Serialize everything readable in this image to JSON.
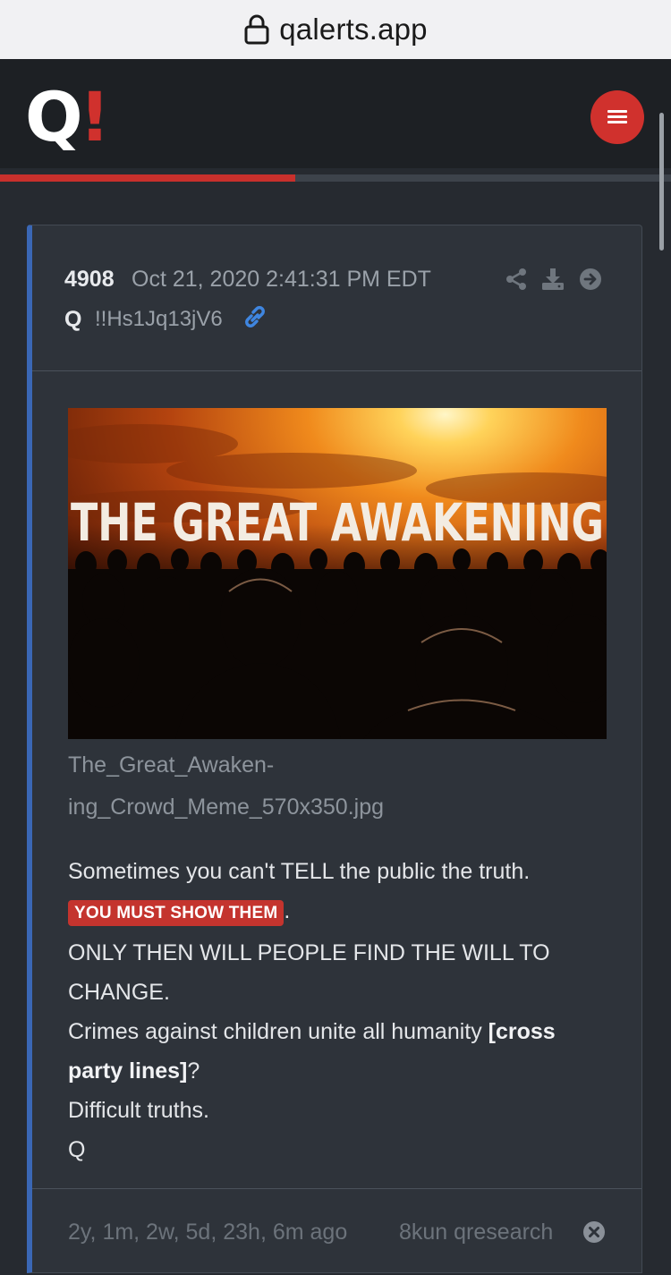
{
  "browser": {
    "url": "qalerts.app"
  },
  "header": {
    "logo_q": "Q",
    "logo_bang": "!",
    "accent_color": "#d0312d",
    "reading_progress": 0.44
  },
  "post": {
    "number": "4908",
    "date": "Oct 21, 2020 2:41:31 PM EDT",
    "author": "Q",
    "tripcode": "!!Hs1Jq13jV6",
    "image": {
      "caption_text": "THE GREAT AWAKENING",
      "filename_line1": "The_Great_Awaken-",
      "filename_line2": "ing_Crowd_Meme_570x350.jpg"
    },
    "body": {
      "line1": "Sometimes you can't TELL the public the truth.",
      "highlight": "YOU MUST SHOW THEM",
      "highlight_after": ".",
      "line3": "ONLY THEN WILL PEOPLE FIND THE WILL TO CHANGE.",
      "line4_pre": "Crimes against children unite all humanity ",
      "line4_bold": "[cross party lines]",
      "line4_post": "?",
      "line5": "Difficult truths.",
      "signature": "Q"
    },
    "footer": {
      "ago": "2y, 1m, 2w, 5d, 23h, 6m ago",
      "board": "8kun qresearch"
    }
  },
  "icons": [
    "lock-icon",
    "menu-icon",
    "link-icon",
    "share-icon",
    "download-icon",
    "arrow-right-circle-icon",
    "close-circle-icon"
  ]
}
